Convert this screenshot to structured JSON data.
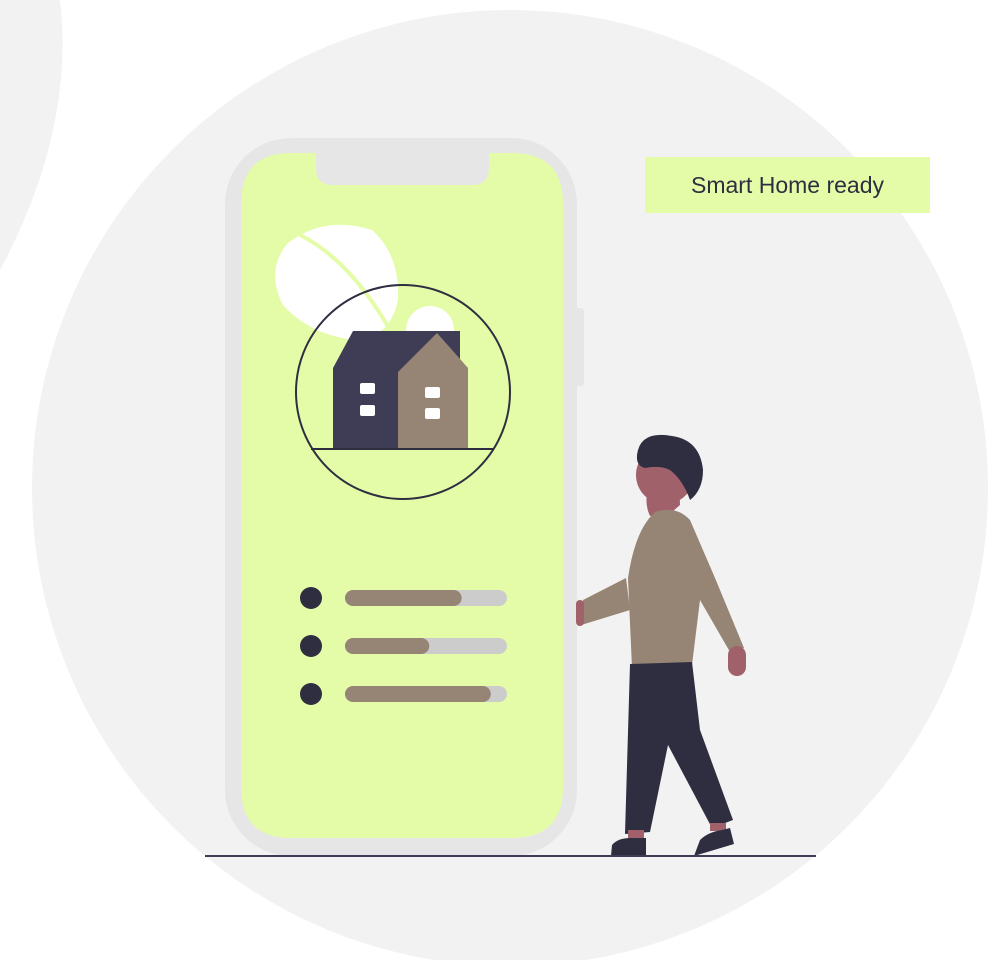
{
  "caption": "Smart Home ready",
  "colors": {
    "accent": "#e4fca7",
    "phone_frame": "#e6e6e6",
    "background_circle": "#f2f2f2",
    "dark": "#2f2e41",
    "brown": "#968474",
    "track": "#cccccc",
    "skin": "#a0616a"
  },
  "settings": [
    {
      "level": 0.72
    },
    {
      "level": 0.52
    },
    {
      "level": 0.9
    }
  ]
}
